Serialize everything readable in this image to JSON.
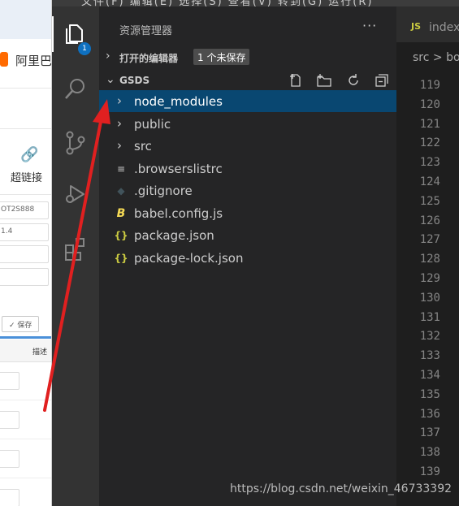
{
  "background_page": {
    "brand_text": "阿里巴",
    "hyperlink_label": "超链接",
    "field1_value": "OT2S888",
    "field2_value": "1.4",
    "save_button": "✓ 保存",
    "column_desc": "描述"
  },
  "titlebar": {
    "menu_text": "文件(F) 编辑(E) 选择(S) 查看(V) 转到(G) 运行(R)"
  },
  "activity_bar": {
    "explorer_badge": "1",
    "icons": [
      "files-icon",
      "search-icon",
      "source-control-icon",
      "run-debug-icon",
      "extensions-icon"
    ]
  },
  "sidebar": {
    "title": "资源管理器",
    "more_label": "···",
    "open_editors": {
      "label": "打开的编辑器",
      "unsaved_badge": "1 个未保存"
    },
    "folder": {
      "label": "GSDS"
    },
    "tree": [
      {
        "name": "node_modules",
        "type": "folder",
        "icon": "chevron-right-icon",
        "selected": true
      },
      {
        "name": "public",
        "type": "folder",
        "icon": "chevron-right-icon",
        "selected": false
      },
      {
        "name": "src",
        "type": "folder",
        "icon": "chevron-right-icon",
        "selected": false
      },
      {
        "name": ".browserslistrc",
        "type": "file",
        "icon": "lines-icon",
        "glyph": "≡",
        "color": "#cccccc"
      },
      {
        "name": ".gitignore",
        "type": "file",
        "icon": "git-icon",
        "glyph": "◆",
        "color": "#41535b"
      },
      {
        "name": "babel.config.js",
        "type": "file",
        "icon": "babel-icon",
        "glyph": "B",
        "color": "#f5da55"
      },
      {
        "name": "package.json",
        "type": "file",
        "icon": "json-icon",
        "glyph": "{}",
        "color": "#cbcb41"
      },
      {
        "name": "package-lock.json",
        "type": "file",
        "icon": "json-icon",
        "glyph": "{}",
        "color": "#cbcb41"
      }
    ]
  },
  "editor": {
    "tab_label": "index",
    "tab_icon": "JS",
    "breadcrumb": "src > bo",
    "line_numbers": [
      "119",
      "120",
      "121",
      "122",
      "123",
      "124",
      "125",
      "126",
      "127",
      "128",
      "129",
      "130",
      "131",
      "132",
      "133",
      "134",
      "135",
      "136",
      "137",
      "138",
      "139"
    ]
  },
  "watermark": "https://blog.csdn.net/weixin_46733392",
  "colors": {
    "selection": "#094771",
    "activity_bar": "#333333",
    "sidebar": "#252526",
    "editor": "#1e1e1e",
    "arrow": "#e02020",
    "badge": "#0e70c0"
  }
}
